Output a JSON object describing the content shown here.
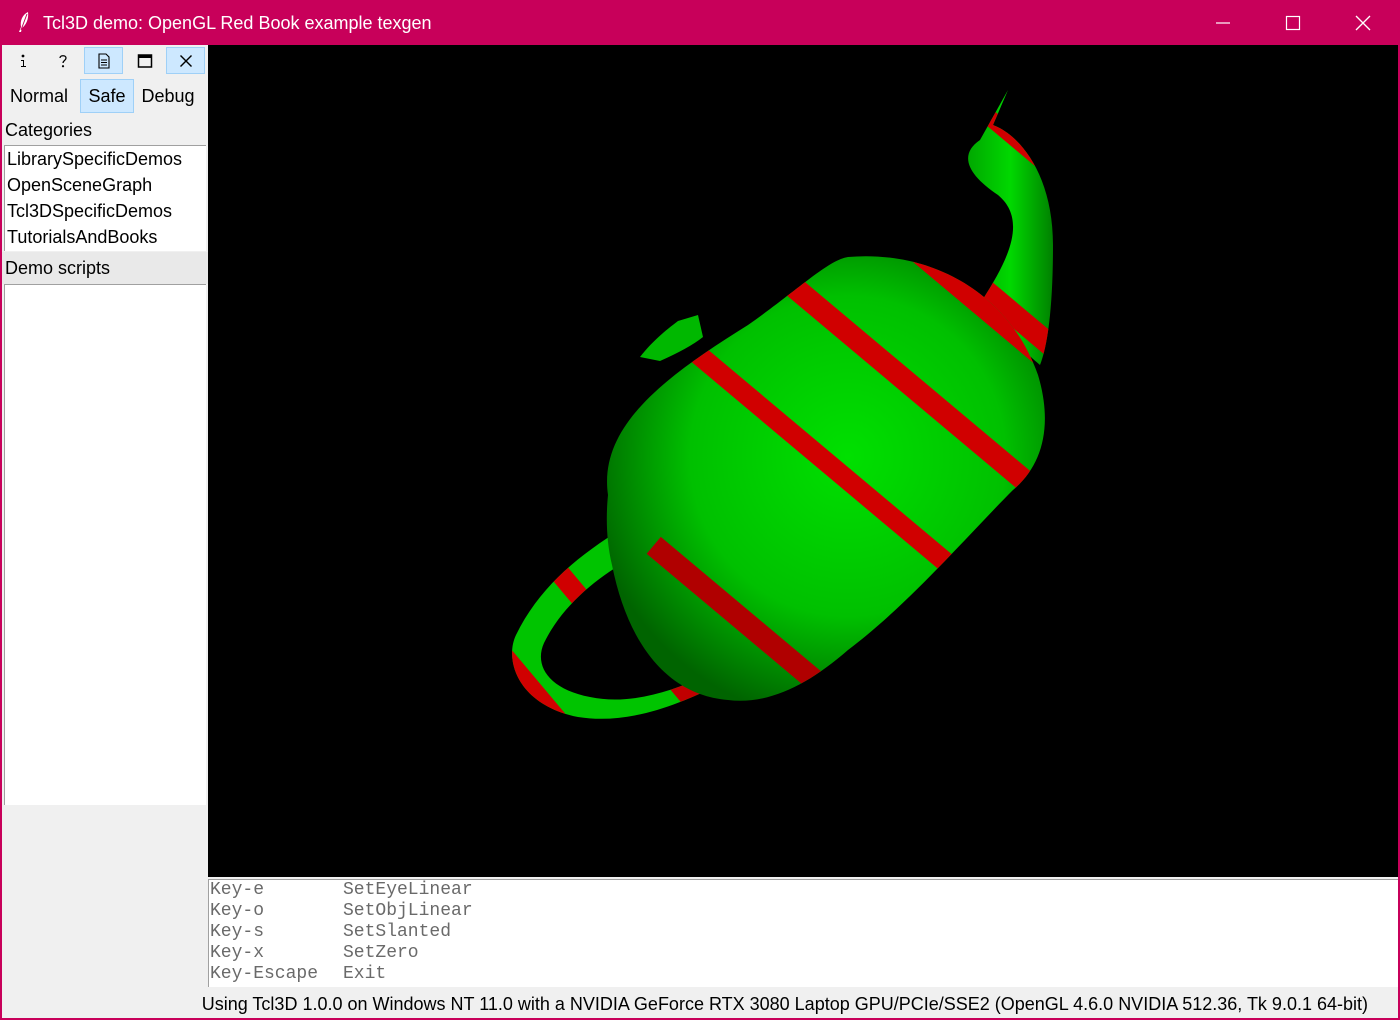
{
  "window": {
    "title": "Tcl3D demo: OpenGL Red Book example texgen",
    "app_icon": "feather-icon",
    "accent_color": "#c8005a",
    "controls": {
      "minimize_icon": "minimize-icon",
      "maximize_icon": "maximize-icon",
      "close_icon": "close-icon"
    }
  },
  "toolbar": {
    "buttons": [
      {
        "icon": "info-icon",
        "active": false
      },
      {
        "icon": "help-icon",
        "active": false
      },
      {
        "icon": "document-icon",
        "active": true
      },
      {
        "icon": "window-icon",
        "active": false
      },
      {
        "icon": "close-icon",
        "active": true
      }
    ]
  },
  "modes": {
    "items": [
      "Normal",
      "Safe",
      "Debug"
    ],
    "selected": "Safe"
  },
  "categories": {
    "label": "Categories",
    "items": [
      "LibrarySpecificDemos",
      "OpenSceneGraph",
      "Tcl3DSpecificDemos",
      "TutorialsAndBooks"
    ]
  },
  "demo_scripts": {
    "label": "Demo scripts",
    "items": []
  },
  "canvas": {
    "background": "#000000",
    "object": "teapot",
    "base_color": "#00d000",
    "stripe_color": "#d00000"
  },
  "key_help": [
    {
      "key": "Key-e",
      "action": "SetEyeLinear"
    },
    {
      "key": "Key-o",
      "action": "SetObjLinear"
    },
    {
      "key": "Key-s",
      "action": "SetSlanted"
    },
    {
      "key": "Key-x",
      "action": "SetZero"
    },
    {
      "key": "Key-Escape",
      "action": "Exit"
    }
  ],
  "status": {
    "text": "Using Tcl3D 1.0.0 on Windows NT 11.0 with a NVIDIA GeForce RTX 3080 Laptop GPU/PCIe/SSE2 (OpenGL 4.6.0 NVIDIA 512.36, Tk 9.0.1 64-bit)"
  }
}
